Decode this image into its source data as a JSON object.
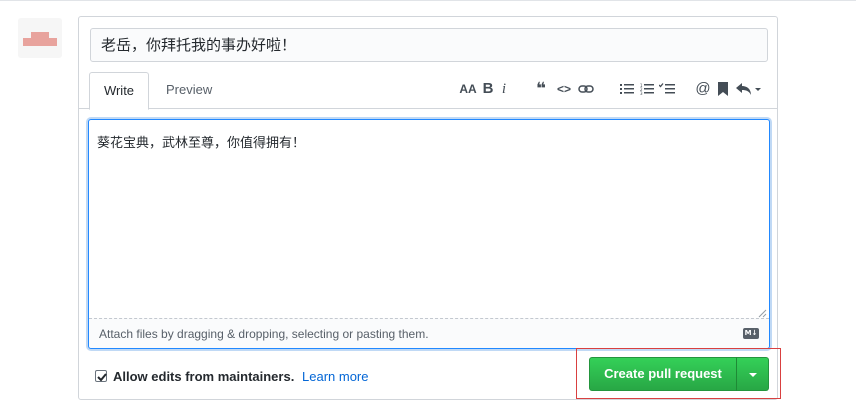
{
  "pr_form": {
    "title_value": "老岳，你拜托我的事办好啦！",
    "tabs": [
      {
        "label": "Write",
        "active": true
      },
      {
        "label": "Preview",
        "active": false
      }
    ],
    "toolbar": {
      "icons": [
        "text-size-icon",
        "bold-icon",
        "italic-icon",
        "quote-icon",
        "code-icon",
        "link-icon",
        "bulleted-list-icon",
        "numbered-list-icon",
        "task-list-icon",
        "mention-icon",
        "saved-reply-icon",
        "reply-icon"
      ],
      "header_glyph": "AA",
      "bold_glyph": "B",
      "italic_glyph": "i",
      "quote_glyph": "❝",
      "code_glyph": "<>",
      "mention_glyph": "@"
    },
    "body_value": "葵花宝典，武林至尊，你值得拥有！",
    "attach_hint": "Attach files by dragging & dropping, selecting or pasting them.",
    "markdown_badge": "M↓",
    "allow_edits": {
      "checked": true,
      "label": "Allow edits from maintainers.",
      "learn_more": "Learn more"
    },
    "create_button": "Create pull request"
  },
  "colors": {
    "button_green": "#2ea44f",
    "link_blue": "#0366d6",
    "focus_blue": "#2188ff",
    "highlight_red": "#d94040"
  }
}
